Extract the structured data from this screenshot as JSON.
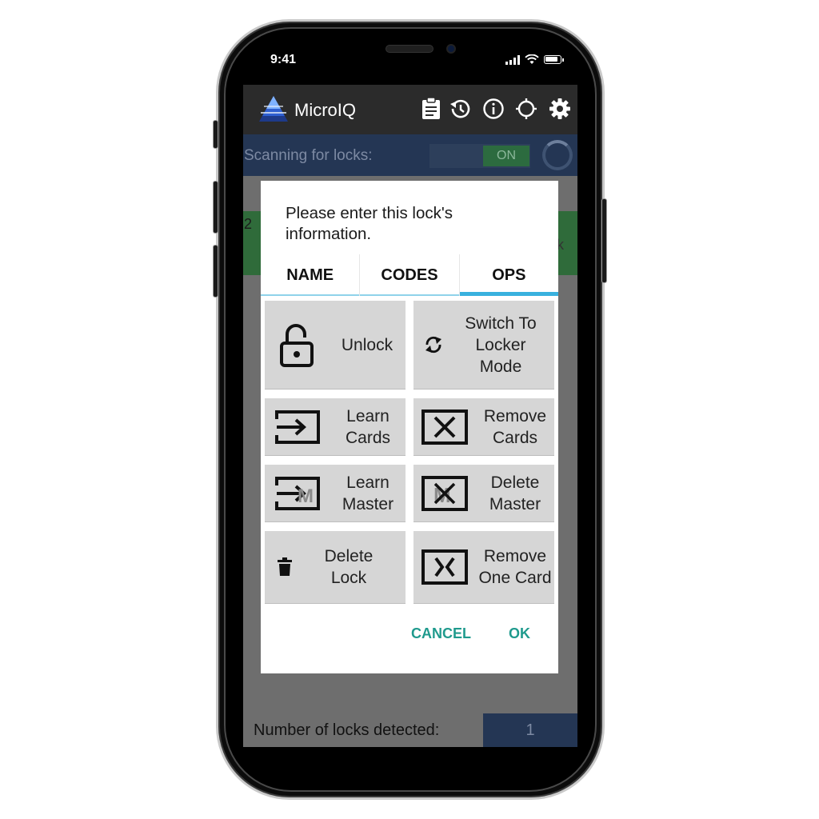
{
  "status": {
    "time": "9:41"
  },
  "app": {
    "title": "MicroIQ"
  },
  "toolbar": {
    "icons": [
      "clipboard-icon",
      "history-icon",
      "info-icon",
      "crosshair-icon",
      "gear-icon"
    ]
  },
  "scan": {
    "label": "Scanning for locks:",
    "toggle": "ON"
  },
  "background": {
    "left_text": "2",
    "right_text": "k"
  },
  "dialog": {
    "title": "Please enter this lock's information.",
    "tabs": [
      "NAME",
      "CODES",
      "OPS"
    ],
    "active_tab": "OPS",
    "ops": [
      {
        "label": "Unlock",
        "icon": "padlock-open-icon"
      },
      {
        "label": "Switch To Locker Mode",
        "icon": "sync-icon"
      },
      {
        "label": "Learn Cards",
        "icon": "card-enter-icon"
      },
      {
        "label": "Remove Cards",
        "icon": "card-remove-icon"
      },
      {
        "label": "Learn Master",
        "icon": "master-enter-icon"
      },
      {
        "label": "Delete Master",
        "icon": "master-delete-icon"
      },
      {
        "label": "Delete Lock",
        "icon": "trash-icon"
      },
      {
        "label": "Remove One Card",
        "icon": "card-remove-one-icon"
      }
    ],
    "cancel": "CANCEL",
    "ok": "OK"
  },
  "footer": {
    "label": "Number of locks detected:",
    "count": "1"
  },
  "colors": {
    "accent_tab": "#39b1de",
    "action_text": "#1f9a8d",
    "nav_bar": "#243654",
    "toggle_on": "#2c6b3f"
  }
}
